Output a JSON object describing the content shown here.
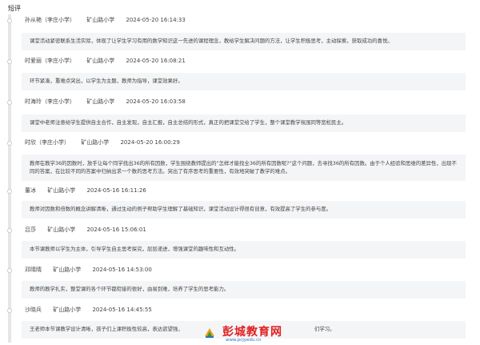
{
  "section_title": "短评",
  "comments": [
    {
      "name": "孙从艳（李庄小学）",
      "school": "矿山路小学",
      "time": "2024-05-20 16:14:33",
      "text": "课堂活动紧密联系生活实际，体现了让学生学习有用的数学知识这一先进的课程理念，教给学生解决问题的方法，让学生积极思考，主动探索，获取成功的喜悦。"
    },
    {
      "name": "时爱丽（李庄小学）",
      "school": "矿山路小学",
      "time": "2024-05-20 16:08:21",
      "text": "环节紧凑，重难点突出，以学生为主题，教师为指导，课堂效果好。"
    },
    {
      "name": "时海玲（李庄小学）",
      "school": "矿山路小学",
      "time": "2024-05-20 16:03:58",
      "text": "课堂中老师注意给学生提供自主合作，自主发现，自主汇报，自主总结的形式，真正的把课堂交给了学生，整个课堂教学氛围同等宽松民主。"
    },
    {
      "name": "时欣（李庄小学）",
      "school": "矿山路小学",
      "time": "2024-05-20 16:00:29",
      "text": "教师在教学36的因数时，放手让每个同学找出36的所有因数，学生围绕教师提出的\"怎样才能找全36的所有因数呢?\"这个问题，去寻找36的所有因数。由于个人经验和思维的差异性，出现不同的答案，在比较不同的答案中归纳出求一个数的思考方法。突出了有序思考的重要性，有效地突破了教学的难点。"
    },
    {
      "name": "董冰",
      "school": "矿山路小学",
      "time": "2024-05-16 16:11:26",
      "text": "教师对因数和倍数的概念讲解清晰，通过生动的例子帮助学生理解了基础知识，课堂活动设计得很有创意，有效提高了学生的参与度。"
    },
    {
      "name": "吕莎",
      "school": "矿山路小学",
      "time": "2024-05-16 15:06:01",
      "text": "本节课教师以学生为主体，引导学生自主思考探究，层层递进，增强课堂的趣味性和互动性。"
    },
    {
      "name": "邓晴晴",
      "school": "矿山路小学",
      "time": "2024-05-16 14:53:00",
      "text": "教师的教学扎实，整堂课的各个环节都衔接的很好，由易到难，培养了学生的思考能力。"
    },
    {
      "name": "沙晓兵",
      "school": "矿山路小学",
      "time": "2024-05-16 14:45:55",
      "text": "王老师本节课教学设计清晰，孩子们上课积极性较高，表达欲望强，"
    }
  ],
  "last_text_tail": "们学习。",
  "watermark": {
    "title": "彭城教育网",
    "url": "www.pcjyedu.cn"
  },
  "colors": {
    "box_bg": "#f4f5f7",
    "timeline": "#e4e6ea",
    "watermark_red": "#e02020",
    "watermark_blue": "#2d6fc5"
  }
}
